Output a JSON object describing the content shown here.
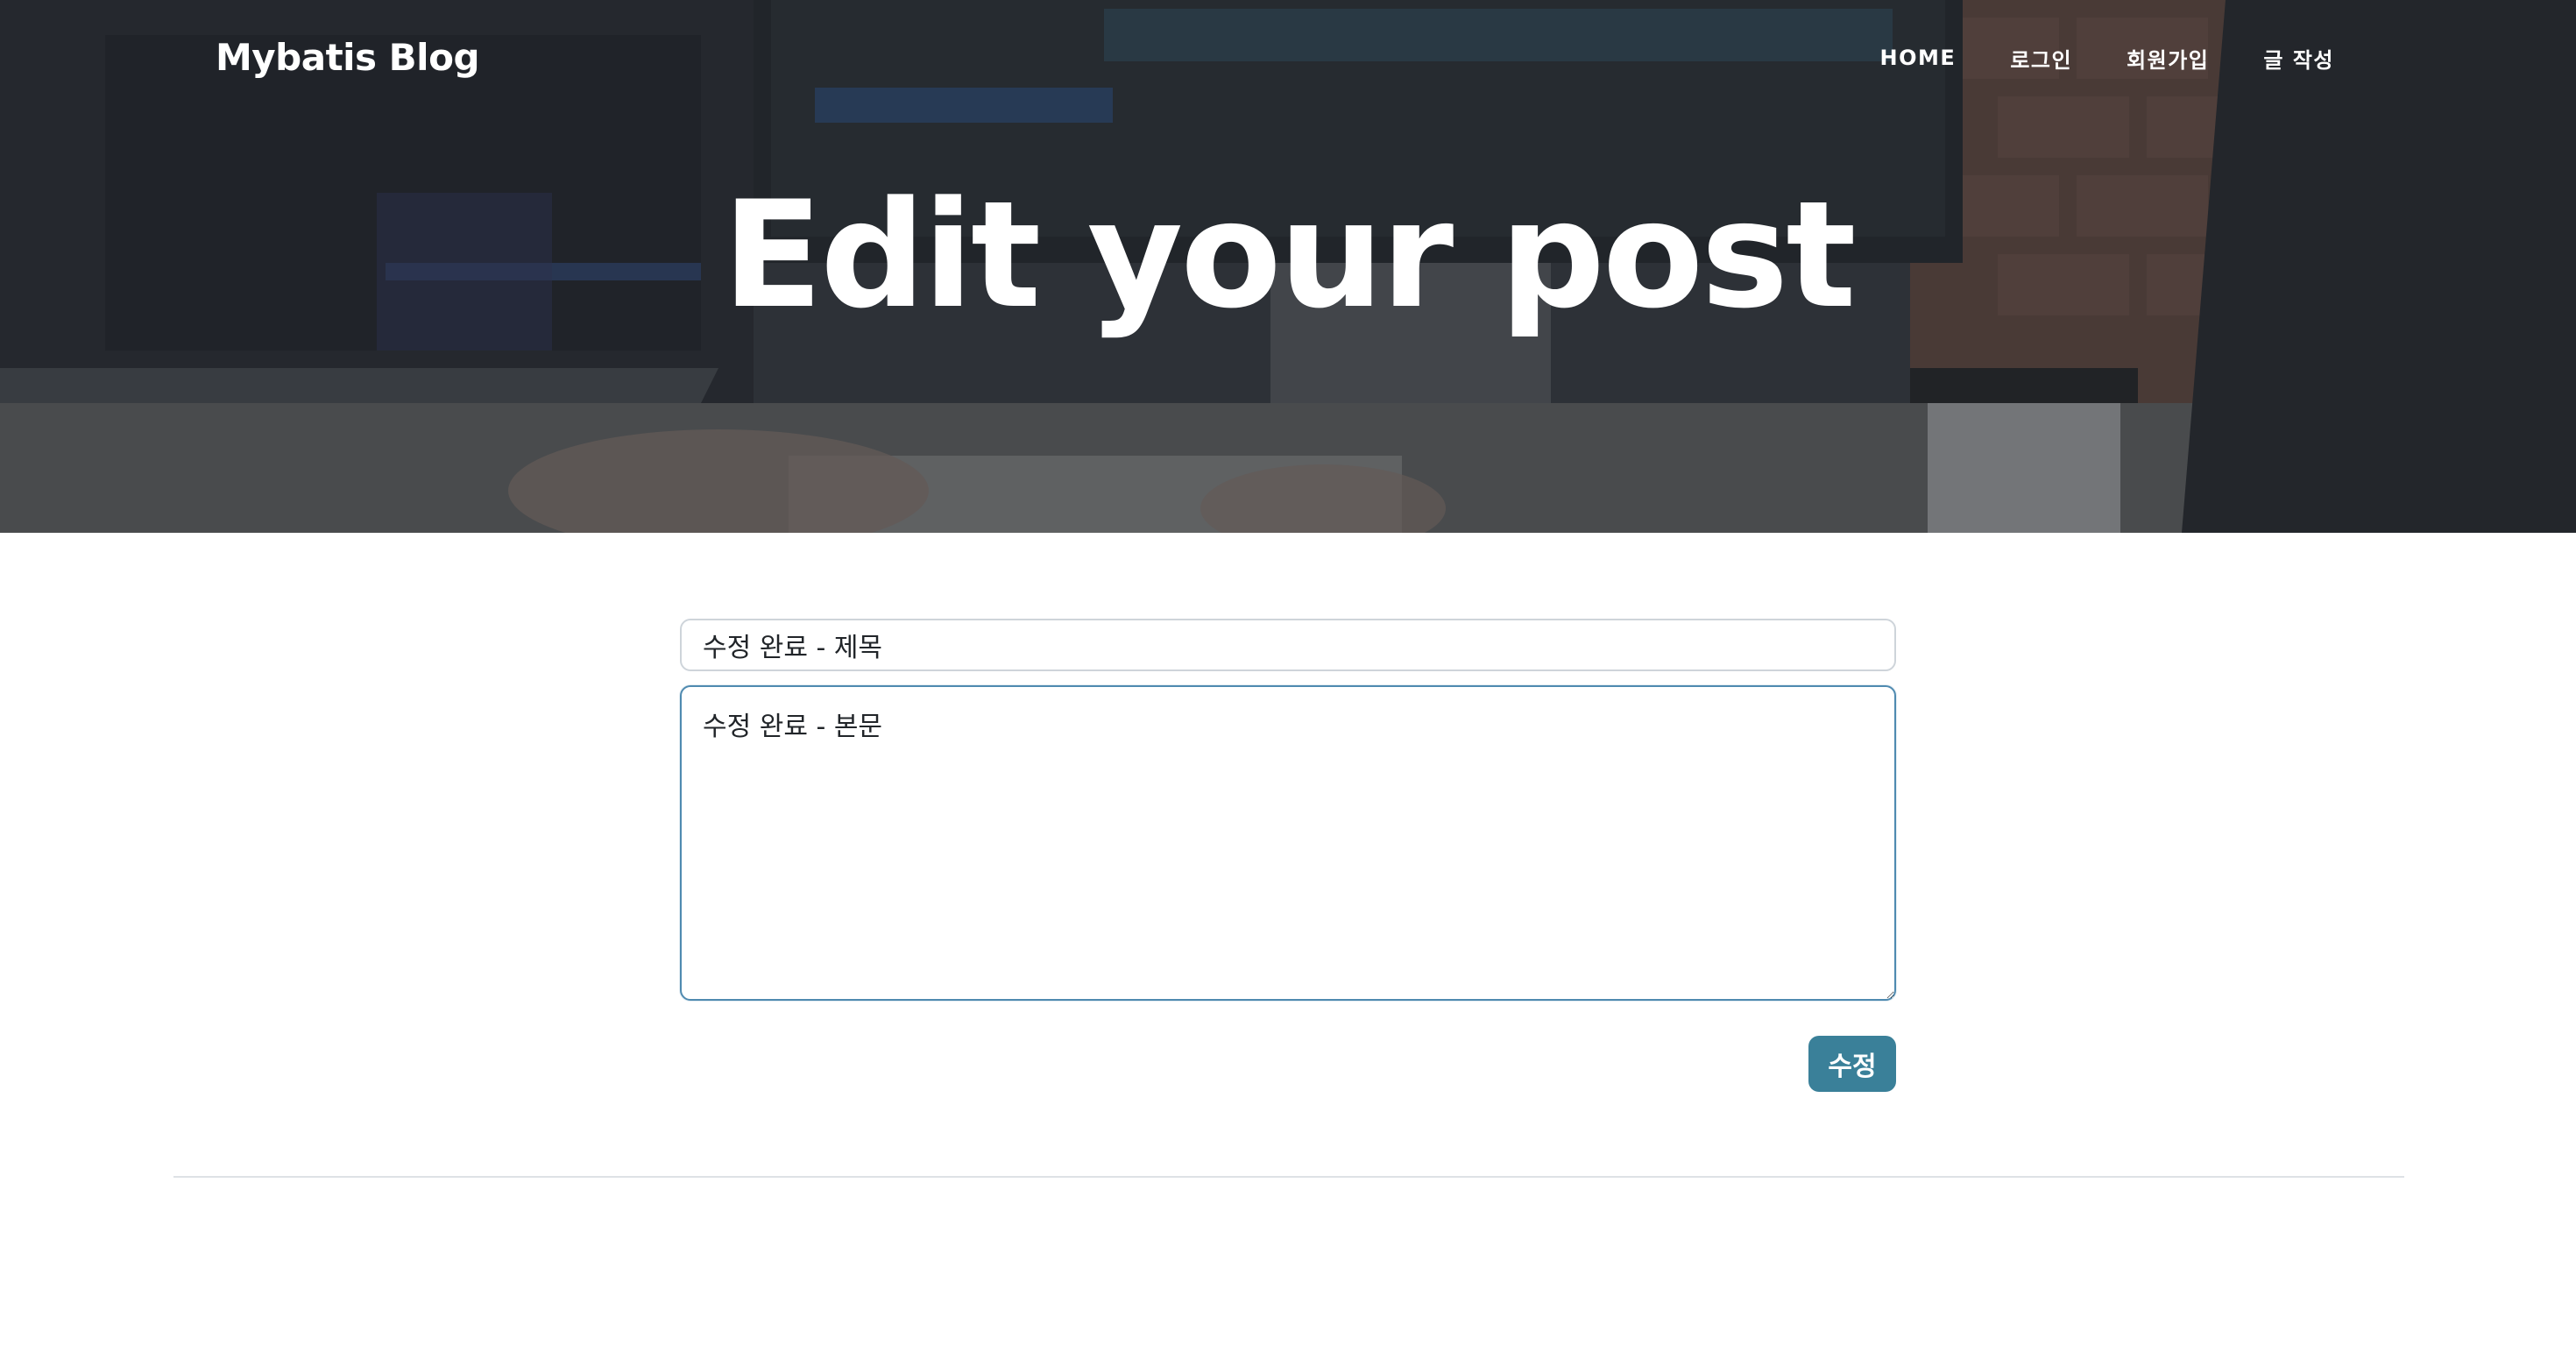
{
  "navbar": {
    "brand": "Mybatis Blog",
    "links": [
      "HOME",
      "로그인",
      "회원가입",
      "글 작성"
    ]
  },
  "hero": {
    "title": "Edit your post"
  },
  "form": {
    "title_value": "수정 완료 - 제목",
    "content_value": "수정 완료 - 본문",
    "submit_label": "수정"
  },
  "colors": {
    "button": "#3a8099",
    "textarea_focus_border": "#4f8ab0",
    "input_border": "#ced4da",
    "divider": "#dee2e6"
  }
}
